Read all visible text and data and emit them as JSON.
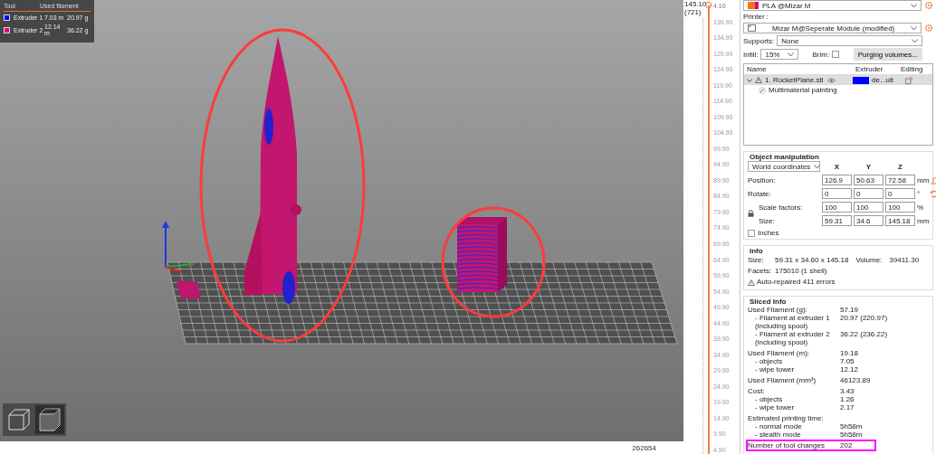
{
  "legend": {
    "columns": [
      "Tool",
      "Used filament"
    ],
    "rows": [
      {
        "name": "Extruder 1",
        "color": "#0000ff",
        "length": "7.03 m",
        "weight": "20.97 g"
      },
      {
        "name": "Extruder 2",
        "color": "#e6007e",
        "length": "12.14 m",
        "weight": "36.22 g"
      }
    ]
  },
  "view_buttons": [
    {
      "kind": "model",
      "selected": false
    },
    {
      "kind": "layers",
      "selected": true
    }
  ],
  "status_number": "262654",
  "layer_slider": {
    "level": 1,
    "value_label": "145.10",
    "layer_label": "(721)",
    "ticks": [
      "4.10",
      "139.90",
      "134.90",
      "129.90",
      "124.90",
      "119.90",
      "114.90",
      "109.90",
      "104.90",
      "99.90",
      "94.90",
      "89.90",
      "84.90",
      "79.90",
      "74.90",
      "69.90",
      "64.90",
      "59.90",
      "54.90",
      "49.90",
      "44.90",
      "39.90",
      "34.90",
      "29.90",
      "24.90",
      "19.90",
      "14.90",
      "9.90",
      "4.90"
    ]
  },
  "filament": {
    "value": "PLA @Mizar M"
  },
  "printer": {
    "label": "Printer :",
    "value": "Mizar M@Seperate Module (modified)"
  },
  "supports": {
    "label": "Supports:",
    "value": "None"
  },
  "infill": {
    "label": "Infill:",
    "value": "15%"
  },
  "brim": {
    "label": "Brim:",
    "checked": false
  },
  "purging_button": "Purging volumes...",
  "object_list": {
    "columns": [
      "Name",
      "Extruder",
      "Editing"
    ],
    "objects": [
      {
        "name": "1. RocketPlane.stl",
        "expanded": true,
        "selected": true,
        "extruder": "de...ult",
        "color": "#0000ff",
        "children": [
          {
            "name": "Multimaterial painting"
          }
        ]
      }
    ]
  },
  "manipulation": {
    "title": "Object manipulation",
    "mode": "World coordinates",
    "axes": [
      "X",
      "Y",
      "Z"
    ],
    "rows": [
      {
        "kind": "position",
        "label": "Position:",
        "values": [
          "126.9",
          "50.63",
          "72.58"
        ],
        "unit": "mm"
      },
      {
        "kind": "rotate",
        "label": "Rotate:",
        "values": [
          "0",
          "0",
          "0"
        ],
        "unit": "°"
      },
      {
        "kind": "scale",
        "label": "Scale factors:",
        "values": [
          "100",
          "100",
          "100"
        ],
        "unit": "%"
      },
      {
        "kind": "size",
        "label": "Size:",
        "values": [
          "59.31",
          "34.6",
          "145.18"
        ],
        "unit": "mm"
      }
    ],
    "inches": {
      "label": "Inches",
      "checked": false
    }
  },
  "info": {
    "title": "Info",
    "size_label": "Size:",
    "size": "59.31 x 34.60 x 145.18",
    "volume_label": "Volume:",
    "volume": "39411.30",
    "facets_label": "Facets:",
    "facets": "175010 (1 shell)",
    "warning": "Auto-repaired 411 errors"
  },
  "sliced_info": {
    "title": "Sliced Info",
    "groups": [
      {
        "label": "Used Filament (g):",
        "value": "57.19",
        "highlighted": false,
        "children": [
          {
            "label": "- Filament at extruder 1",
            "note": "(including spool)",
            "value": "20.97 (220.97)"
          },
          {
            "label": "- Filament at extruder 2",
            "note": "(including spool)",
            "value": "36.22 (236.22)"
          }
        ]
      },
      {
        "label": "Used Filament (m):",
        "value": "19.18",
        "highlighted": false,
        "children": [
          {
            "label": "- objects",
            "value": "7.05"
          },
          {
            "label": "- wipe tower",
            "value": "12.12"
          }
        ]
      },
      {
        "label": "Used Filament (mm³)",
        "value": "46123.89",
        "highlighted": false
      },
      {
        "label": "Cost:",
        "value": "3.43",
        "highlighted": false,
        "children": [
          {
            "label": "- objects",
            "value": "1.26"
          },
          {
            "label": "- wipe tower",
            "value": "2.17"
          }
        ]
      },
      {
        "label": "Estimated printing time:",
        "highlighted": false,
        "children": [
          {
            "label": "- normal mode",
            "value": "5h58m"
          },
          {
            "label": "- stealth mode",
            "value": "5h58m"
          }
        ]
      },
      {
        "label": "Number of tool changes",
        "value": "202",
        "highlighted": true
      }
    ]
  }
}
